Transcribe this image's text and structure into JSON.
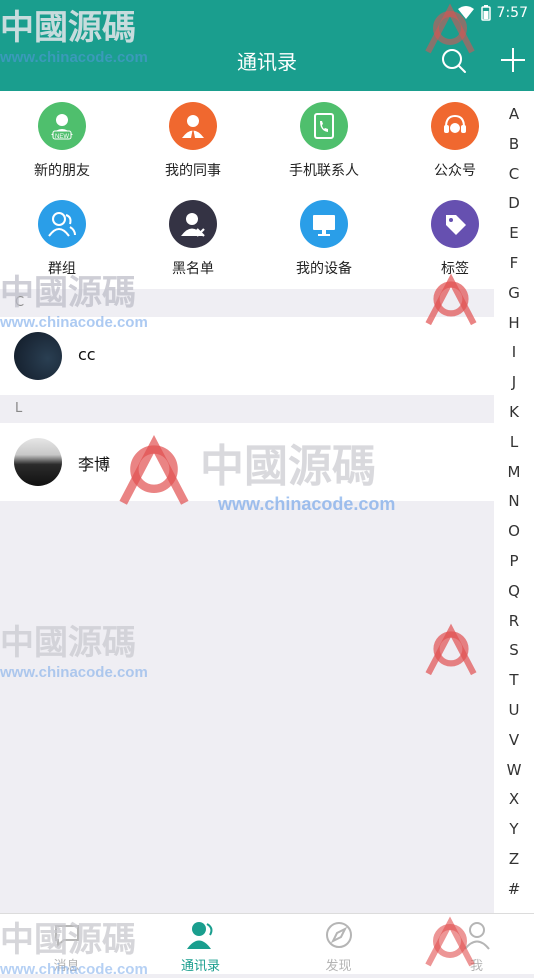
{
  "header": {
    "title": "通讯录"
  },
  "status": {
    "time": "7:57"
  },
  "tiles": [
    {
      "label": "新的朋友",
      "color": "#4fbf6d",
      "icon": "new-friend-icon",
      "badge": "NEW"
    },
    {
      "label": "我的同事",
      "color": "#f0682f",
      "icon": "colleague-icon"
    },
    {
      "label": "手机联系人",
      "color": "#4fbf6d",
      "icon": "phone-contact-icon"
    },
    {
      "label": "公众号",
      "color": "#f0682f",
      "icon": "headset-icon"
    },
    {
      "label": "群组",
      "color": "#2a9ee8",
      "icon": "group-icon"
    },
    {
      "label": "黑名单",
      "color": "#343344",
      "icon": "blacklist-icon"
    },
    {
      "label": "我的设备",
      "color": "#2a9ee8",
      "icon": "monitor-icon"
    },
    {
      "label": "标签",
      "color": "#6650b0",
      "icon": "tag-icon"
    }
  ],
  "sections": [
    {
      "letter": "C",
      "contacts": [
        {
          "name": "cc"
        }
      ]
    },
    {
      "letter": "L",
      "contacts": [
        {
          "name": "李博"
        }
      ]
    }
  ],
  "index": [
    "A",
    "B",
    "C",
    "D",
    "E",
    "F",
    "G",
    "H",
    "I",
    "J",
    "K",
    "L",
    "M",
    "N",
    "O",
    "P",
    "Q",
    "R",
    "S",
    "T",
    "U",
    "V",
    "W",
    "X",
    "Y",
    "Z",
    "#"
  ],
  "tabs": [
    {
      "label": "消息",
      "active": false,
      "icon": "chat-icon"
    },
    {
      "label": "通讯录",
      "active": true,
      "icon": "contacts-icon"
    },
    {
      "label": "发现",
      "active": false,
      "icon": "compass-icon"
    },
    {
      "label": "我",
      "active": false,
      "icon": "person-icon"
    }
  ],
  "colors": {
    "primary": "#1a9e8e",
    "active_tab": "#1a9e8e",
    "inactive_tab": "#b5b5b5"
  },
  "watermark": {
    "text_cn": "中國源碼",
    "text_url": "www.chinacode.com"
  }
}
